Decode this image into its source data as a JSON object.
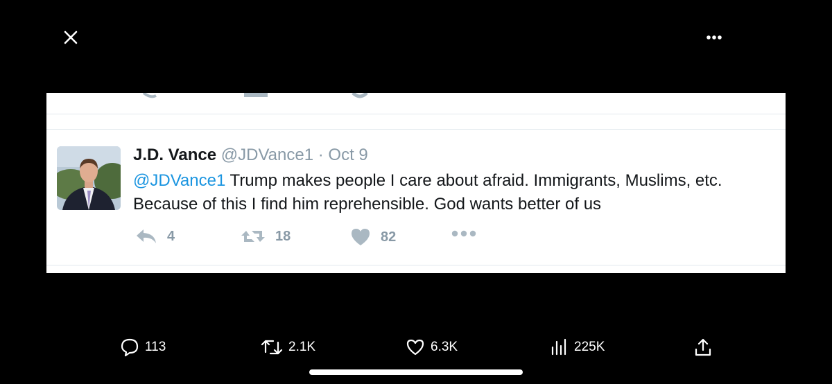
{
  "viewer": {
    "close_icon": "close-icon",
    "more_icon": "more-horizontal-icon"
  },
  "tweet": {
    "name": "J.D. Vance",
    "handle": "@JDVance1",
    "separator": "·",
    "date": "Oct 9",
    "mention": "@JDVance1",
    "line1_rest": " Trump makes people I care about afraid. Immigrants, Muslims, etc.",
    "line2": "Because of this I find him reprehensible. God wants better of us",
    "replies": "4",
    "retweets": "18",
    "likes": "82",
    "colors": {
      "link": "#1b95e0",
      "muted": "#8899a6",
      "text": "#14171a"
    }
  },
  "actions": {
    "replies": "113",
    "reposts": "2.1K",
    "likes": "6.3K",
    "views": "225K"
  }
}
